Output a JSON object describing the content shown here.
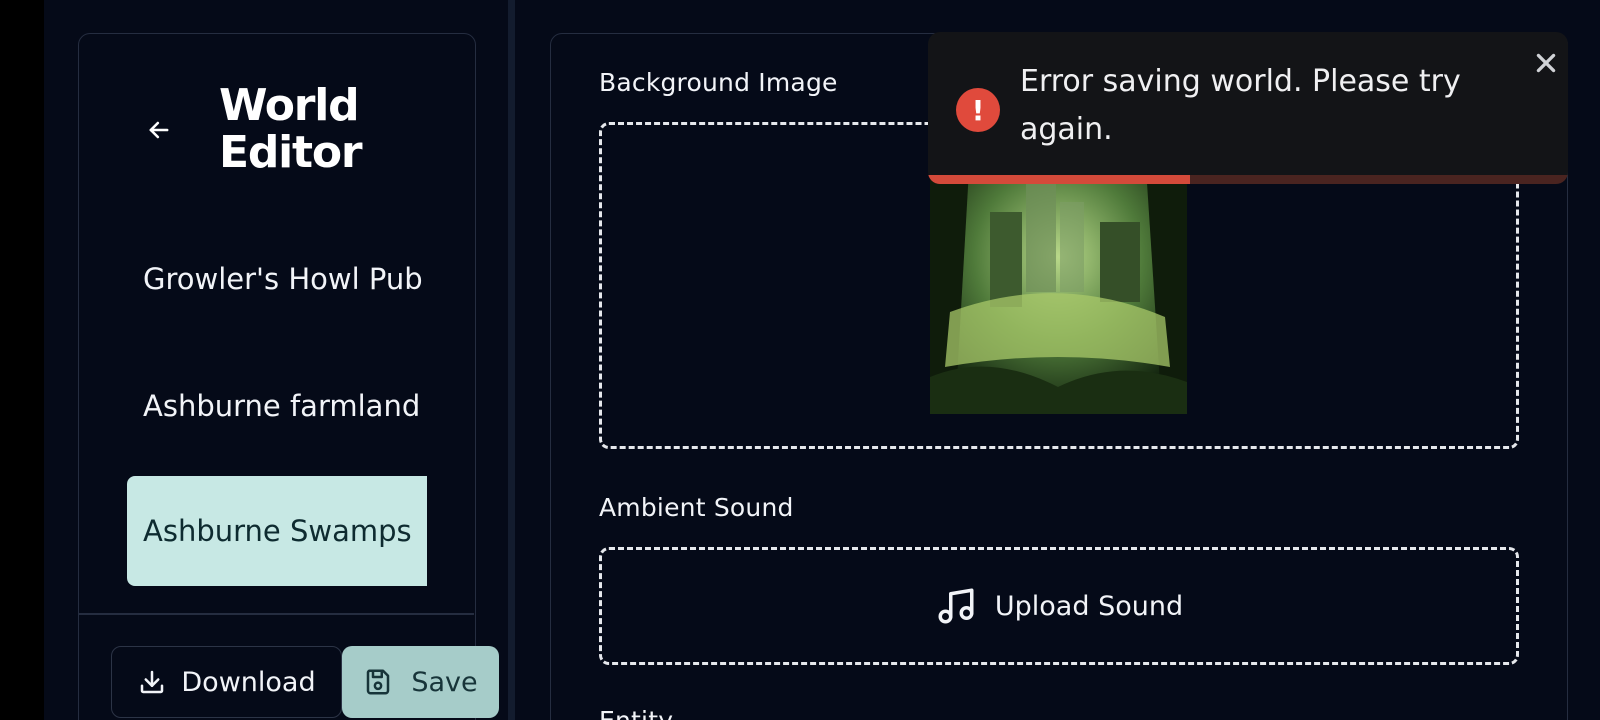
{
  "sidebar": {
    "title_line1": "World",
    "title_line2": "Editor",
    "back_icon": "arrow-left-icon",
    "worlds": [
      {
        "label": "Growler's Howl Pub",
        "active": false
      },
      {
        "label": "Ashburne farmland",
        "active": false
      },
      {
        "label": "Ashburne Swamps",
        "active": true
      }
    ],
    "download_label": "Download",
    "save_label": "Save"
  },
  "editor": {
    "background_image_label": "Background Image",
    "ambient_sound_label": "Ambient Sound",
    "upload_sound_label": "Upload Sound",
    "entity_label": "Entity"
  },
  "toast": {
    "message": "Error saving world. Please try again.",
    "progress": 0.41,
    "icon": "error-icon",
    "close_icon": "close-icon"
  },
  "colors": {
    "background": "#050a18",
    "active_item": "#c7e8e4",
    "save_button": "#a6ccc9",
    "error": "#e04a3c"
  }
}
